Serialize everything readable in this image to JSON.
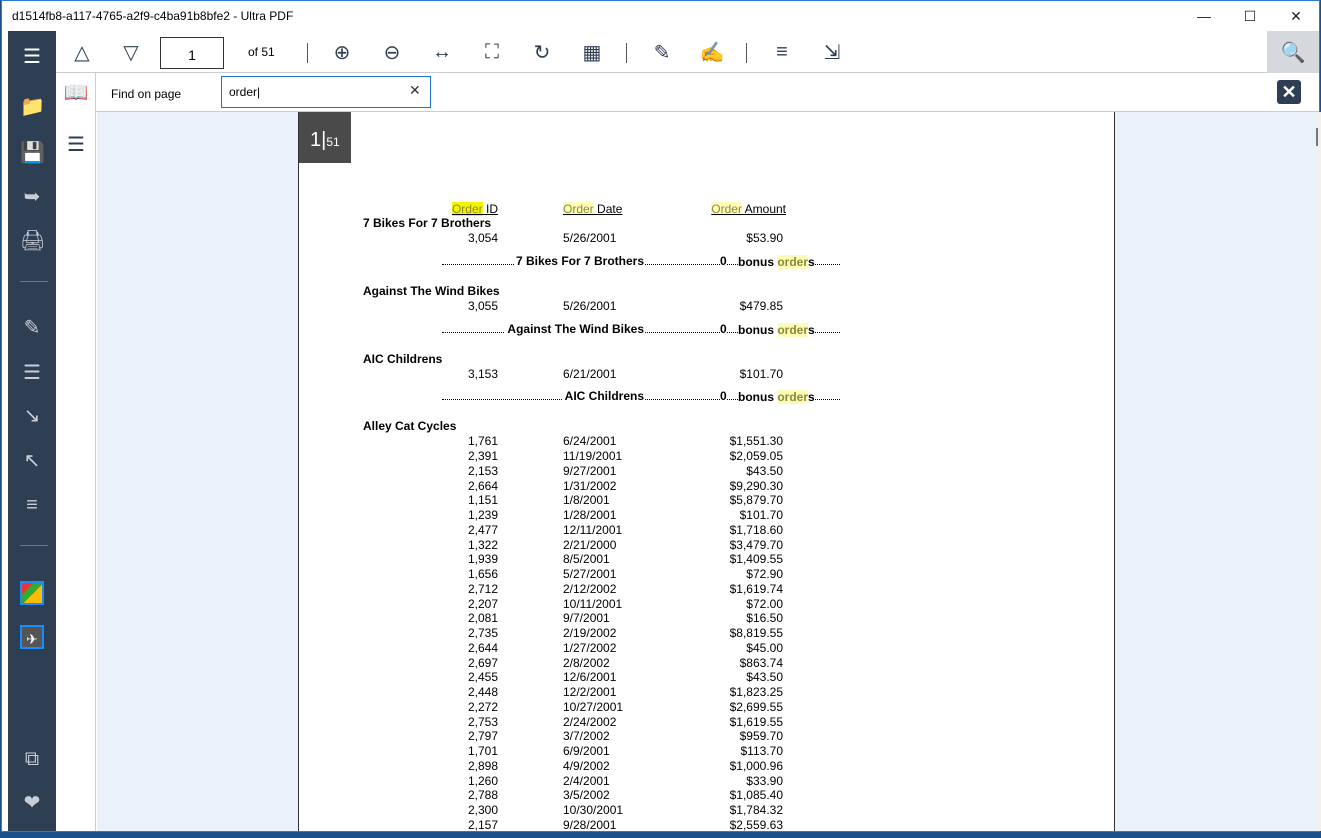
{
  "window": {
    "title": "d1514fb8-a117-4765-a2f9-c4ba91b8bfe2 - Ultra PDF",
    "controls": [
      "minimize",
      "maximize",
      "close"
    ]
  },
  "toolbar": {
    "page_value": "1",
    "page_of": "of 51",
    "icons": [
      "chevron-up",
      "chevron-down",
      "zoom-in",
      "zoom-out",
      "fit-width",
      "fit-page",
      "rotate",
      "grid-view",
      "edit-document",
      "sign-document",
      "reorder-pages",
      "compress"
    ]
  },
  "find": {
    "label": "Find on page",
    "value": "order"
  },
  "page": {
    "badge_num": "1",
    "badge_total": "51",
    "headers": {
      "id_hl": "Order",
      "id": " ID",
      "date_hl": "Order",
      "date": " Date",
      "amount_hl": "Order",
      "amount": " Amount"
    },
    "bonus": "bonus",
    "bonus_hl": "order",
    "bonus_s": "s",
    "groups": [
      {
        "name": "7 Bikes For 7 Brothers",
        "rows": [
          [
            "3,054",
            "5/26/2001",
            "$53.90"
          ]
        ],
        "count": "0"
      },
      {
        "name": "Against The Wind Bikes",
        "rows": [
          [
            "3,055",
            "5/26/2001",
            "$479.85"
          ]
        ],
        "count": "0"
      },
      {
        "name": "AIC Childrens",
        "rows": [
          [
            "3,153",
            "6/21/2001",
            "$101.70"
          ]
        ],
        "count": "0"
      },
      {
        "name": "Alley Cat Cycles",
        "rows": [
          [
            "1,761",
            "6/24/2001",
            "$1,551.30"
          ],
          [
            "2,391",
            "11/19/2001",
            "$2,059.05"
          ],
          [
            "2,153",
            "9/27/2001",
            "$43.50"
          ],
          [
            "2,664",
            "1/31/2002",
            "$9,290.30"
          ],
          [
            "1,151",
            "1/8/2001",
            "$5,879.70"
          ],
          [
            "1,239",
            "1/28/2001",
            "$101.70"
          ],
          [
            "2,477",
            "12/11/2001",
            "$1,718.60"
          ],
          [
            "1,322",
            "2/21/2000",
            "$3,479.70"
          ],
          [
            "1,939",
            "8/5/2001",
            "$1,409.55"
          ],
          [
            "1,656",
            "5/27/2001",
            "$72.90"
          ],
          [
            "2,712",
            "2/12/2002",
            "$1,619.74"
          ],
          [
            "2,207",
            "10/11/2001",
            "$72.00"
          ],
          [
            "2,081",
            "9/7/2001",
            "$16.50"
          ],
          [
            "2,735",
            "2/19/2002",
            "$8,819.55"
          ],
          [
            "2,644",
            "1/27/2002",
            "$45.00"
          ],
          [
            "2,697",
            "2/8/2002",
            "$863.74"
          ],
          [
            "2,455",
            "12/6/2001",
            "$43.50"
          ],
          [
            "2,448",
            "12/2/2001",
            "$1,823.25"
          ],
          [
            "2,272",
            "10/27/2001",
            "$2,699.55"
          ],
          [
            "2,753",
            "2/24/2002",
            "$1,619.55"
          ],
          [
            "2,797",
            "3/7/2002",
            "$959.70"
          ],
          [
            "1,701",
            "6/9/2001",
            "$113.70"
          ],
          [
            "2,898",
            "4/9/2002",
            "$1,000.96"
          ],
          [
            "1,260",
            "2/4/2001",
            "$33.90"
          ],
          [
            "2,788",
            "3/5/2002",
            "$1,085.40"
          ],
          [
            "2,300",
            "10/30/2001",
            "$1,784.32"
          ],
          [
            "2,157",
            "9/28/2001",
            "$2,559.63"
          ]
        ]
      }
    ]
  },
  "colors": {
    "sidebar": "#2e3e53",
    "highlight_current": "#f4f400",
    "highlight": "#fdfdb8",
    "viewer_bg": "#eaf1fb"
  }
}
